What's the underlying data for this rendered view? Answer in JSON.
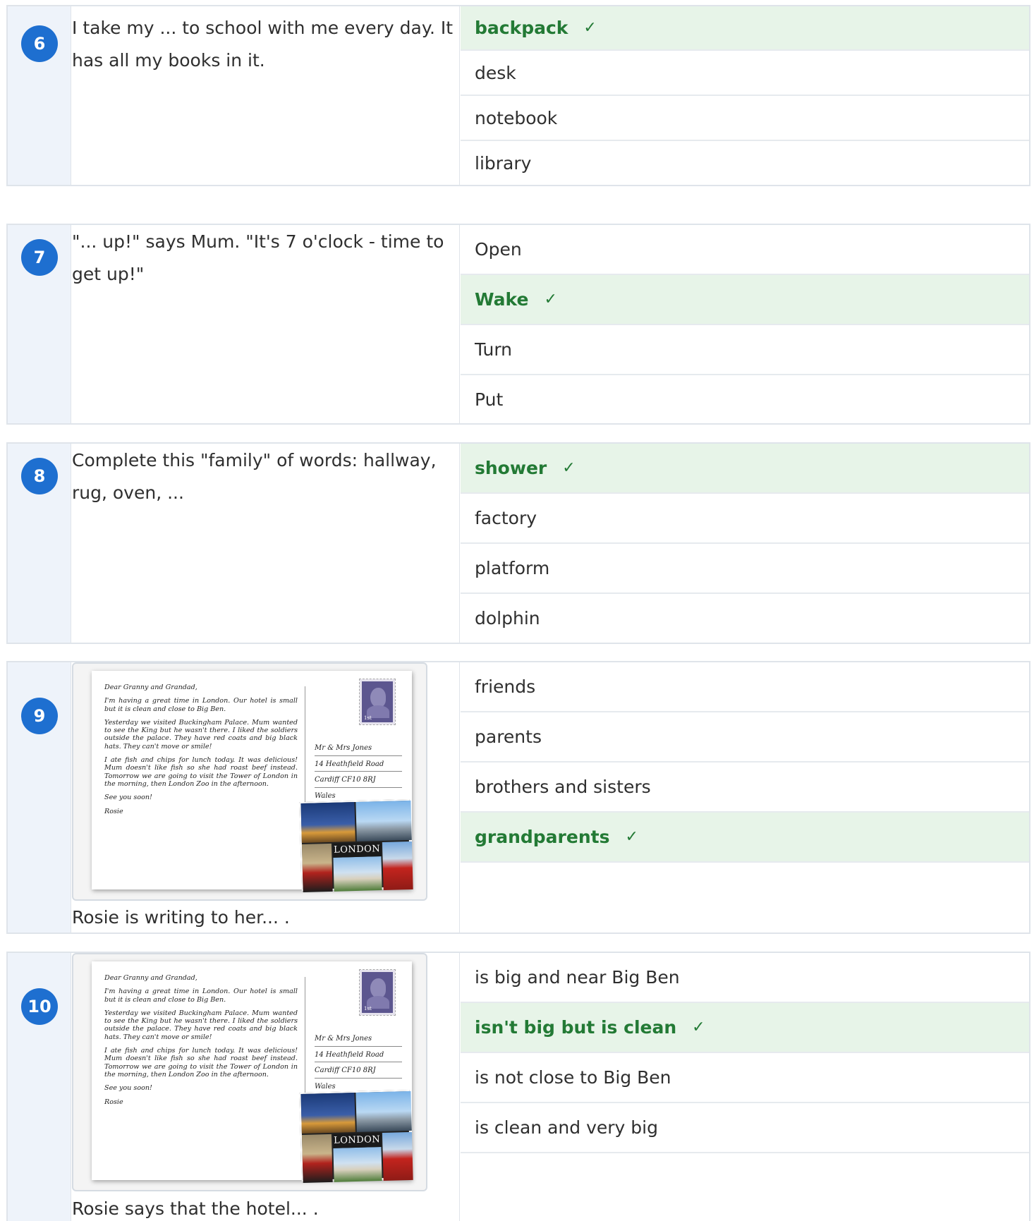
{
  "questions": [
    {
      "number": "6",
      "text": "I take my ... to school with me every day. It has all my books in it.",
      "answers": [
        {
          "label": "backpack",
          "correct": true
        },
        {
          "label": "desk",
          "correct": false
        },
        {
          "label": "notebook",
          "correct": false
        },
        {
          "label": "library",
          "correct": false
        }
      ]
    },
    {
      "number": "7",
      "text": "\"... up!\" says Mum. \"It's 7 o'clock - time to get up!\"",
      "answers": [
        {
          "label": "Open",
          "correct": false
        },
        {
          "label": "Wake",
          "correct": true
        },
        {
          "label": "Turn",
          "correct": false
        },
        {
          "label": "Put",
          "correct": false
        }
      ]
    },
    {
      "number": "8",
      "text": "Complete this \"family\" of words: hallway, rug, oven, ...",
      "answers": [
        {
          "label": "shower",
          "correct": true
        },
        {
          "label": "factory",
          "correct": false
        },
        {
          "label": "platform",
          "correct": false
        },
        {
          "label": "dolphin",
          "correct": false
        }
      ]
    },
    {
      "number": "9",
      "text": "Rosie is writing to her... .",
      "answers": [
        {
          "label": "friends",
          "correct": false
        },
        {
          "label": "parents",
          "correct": false
        },
        {
          "label": "brothers and sisters",
          "correct": false
        },
        {
          "label": "grandparents",
          "correct": true
        }
      ]
    },
    {
      "number": "10",
      "text": "Rosie says that the hotel... .",
      "answers": [
        {
          "label": "is big and near Big Ben",
          "correct": false
        },
        {
          "label": "isn't big but is clean",
          "correct": true
        },
        {
          "label": "is not close to Big Ben",
          "correct": false
        },
        {
          "label": "is clean and very big",
          "correct": false
        }
      ]
    }
  ],
  "check_mark": "✓",
  "postcard": {
    "greeting": "Dear Granny and Grandad,",
    "paragraphs": [
      "I'm having a great time in London. Our hotel is small but it is clean and close to Big Ben.",
      "Yesterday we visited Buckingham Palace. Mum wanted to see the King but he wasn't there. I liked the soldiers outside the palace. They have red coats and big black hats. They can't move or smile!",
      "I ate fish and chips for lunch today. It was delicious! Mum doesn't like fish so she had roast beef instead. Tomorrow we are going to visit the Tower of London in the morning, then London Zoo in the afternoon.",
      "See you soon!"
    ],
    "signature": "Rosie",
    "address": [
      "Mr & Mrs Jones",
      "14 Heathfield Road",
      "Cardiff CF10 8RJ",
      "Wales"
    ],
    "stamp_value": "1st",
    "collage_label": "LONDON"
  },
  "colors": {
    "number_badge": "#1e6fd0",
    "correct_bg": "#e7f4e8",
    "correct_text": "#237a35",
    "border": "#dfe4ea"
  }
}
